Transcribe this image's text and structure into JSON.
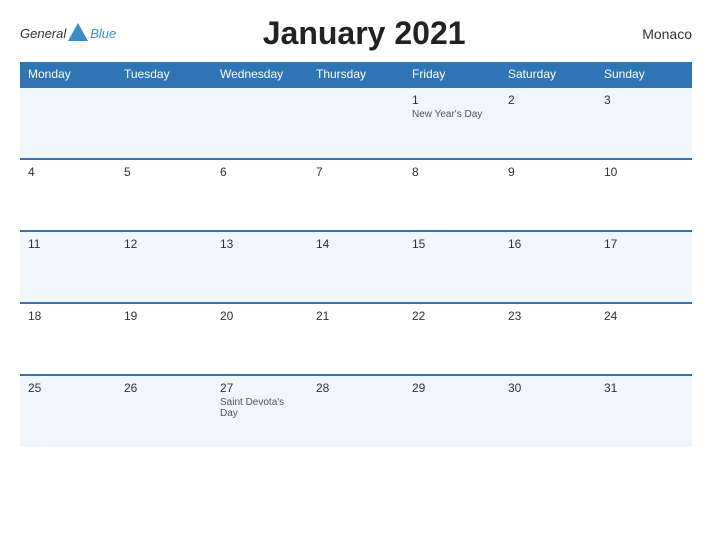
{
  "header": {
    "logo": {
      "general": "General",
      "blue": "Blue"
    },
    "title": "January 2021",
    "country": "Monaco"
  },
  "days_header": [
    "Monday",
    "Tuesday",
    "Wednesday",
    "Thursday",
    "Friday",
    "Saturday",
    "Sunday"
  ],
  "weeks": [
    [
      {
        "day": "",
        "holiday": ""
      },
      {
        "day": "",
        "holiday": ""
      },
      {
        "day": "",
        "holiday": ""
      },
      {
        "day": "",
        "holiday": ""
      },
      {
        "day": "1",
        "holiday": "New Year's Day"
      },
      {
        "day": "2",
        "holiday": ""
      },
      {
        "day": "3",
        "holiday": ""
      }
    ],
    [
      {
        "day": "4",
        "holiday": ""
      },
      {
        "day": "5",
        "holiday": ""
      },
      {
        "day": "6",
        "holiday": ""
      },
      {
        "day": "7",
        "holiday": ""
      },
      {
        "day": "8",
        "holiday": ""
      },
      {
        "day": "9",
        "holiday": ""
      },
      {
        "day": "10",
        "holiday": ""
      }
    ],
    [
      {
        "day": "11",
        "holiday": ""
      },
      {
        "day": "12",
        "holiday": ""
      },
      {
        "day": "13",
        "holiday": ""
      },
      {
        "day": "14",
        "holiday": ""
      },
      {
        "day": "15",
        "holiday": ""
      },
      {
        "day": "16",
        "holiday": ""
      },
      {
        "day": "17",
        "holiday": ""
      }
    ],
    [
      {
        "day": "18",
        "holiday": ""
      },
      {
        "day": "19",
        "holiday": ""
      },
      {
        "day": "20",
        "holiday": ""
      },
      {
        "day": "21",
        "holiday": ""
      },
      {
        "day": "22",
        "holiday": ""
      },
      {
        "day": "23",
        "holiday": ""
      },
      {
        "day": "24",
        "holiday": ""
      }
    ],
    [
      {
        "day": "25",
        "holiday": ""
      },
      {
        "day": "26",
        "holiday": ""
      },
      {
        "day": "27",
        "holiday": "Saint Devota's Day"
      },
      {
        "day": "28",
        "holiday": ""
      },
      {
        "day": "29",
        "holiday": ""
      },
      {
        "day": "30",
        "holiday": ""
      },
      {
        "day": "31",
        "holiday": ""
      }
    ]
  ]
}
